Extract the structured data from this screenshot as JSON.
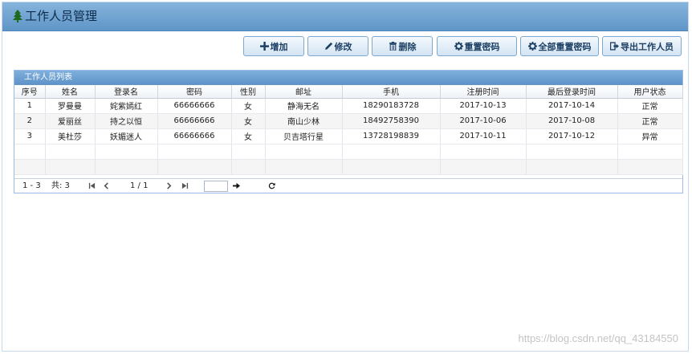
{
  "header": {
    "title": "工作人员管理"
  },
  "toolbar": {
    "buttons": [
      {
        "label": "增加"
      },
      {
        "label": "修改"
      },
      {
        "label": "删除"
      },
      {
        "label": "重置密码"
      },
      {
        "label": "全部重置密码"
      },
      {
        "label": "导出工作人员"
      }
    ]
  },
  "grid": {
    "title": "工作人员列表",
    "columns": [
      "序号",
      "姓名",
      "登录名",
      "密码",
      "性别",
      "邮址",
      "手机",
      "注册时间",
      "最后登录时间",
      "用户状态"
    ],
    "rows": [
      [
        "1",
        "罗曼曼",
        "姹紫嫣红",
        "66666666",
        "女",
        "静海无名",
        "18290183728",
        "2017-10-13",
        "2017-10-14",
        "正常"
      ],
      [
        "2",
        "爱丽丝",
        "持之以恒",
        "66666666",
        "女",
        "南山少林",
        "18492758390",
        "2017-10-06",
        "2017-10-08",
        "正常"
      ],
      [
        "3",
        "美杜莎",
        "妖媚迷人",
        "66666666",
        "女",
        "贝吉塔行星",
        "13728198839",
        "2017-10-11",
        "2017-10-12",
        "异常"
      ]
    ]
  },
  "pager": {
    "range": "1 - 3",
    "total": "共: 3",
    "page": "1 / 1",
    "page_input": ""
  },
  "watermark": "https://blog.csdn.net/qq_43184550"
}
